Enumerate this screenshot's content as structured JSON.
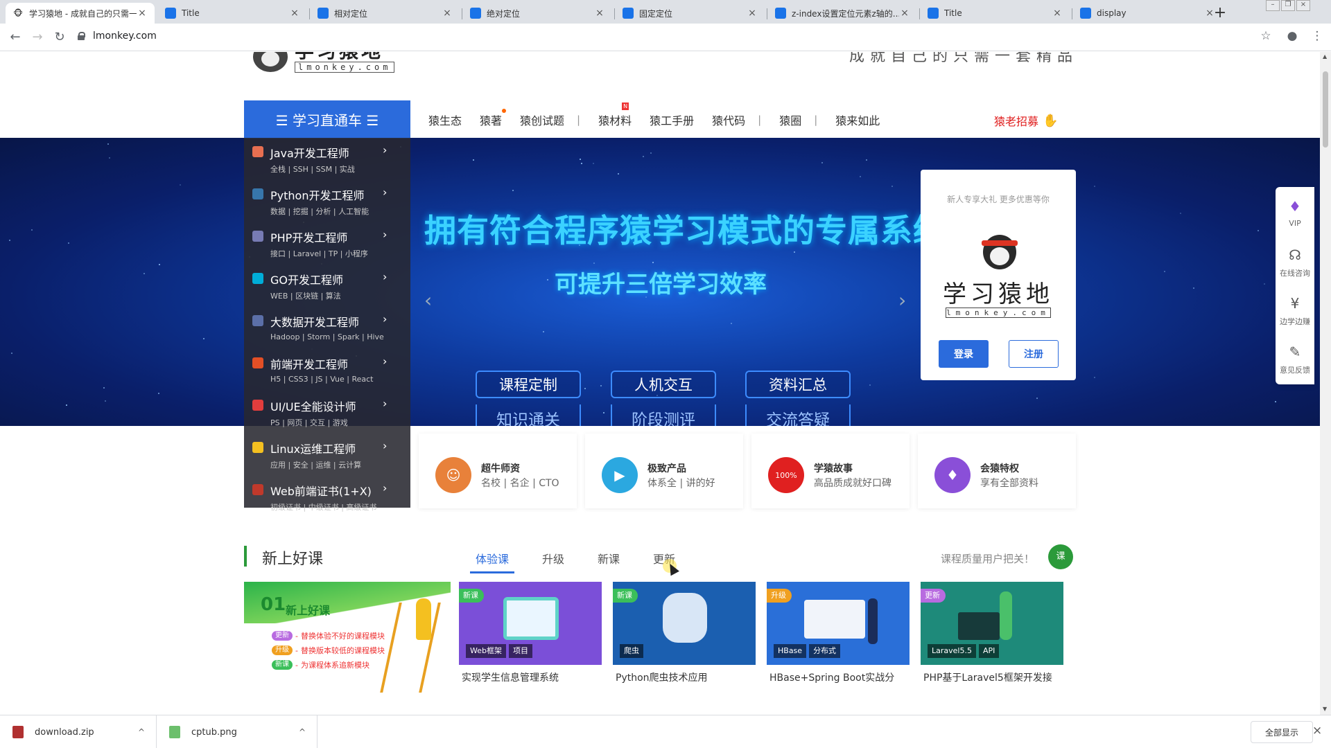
{
  "browser": {
    "tabs": [
      {
        "title": "学习猿地 - 成就自己的只需一...",
        "active": true
      },
      {
        "title": "Title",
        "active": false
      },
      {
        "title": "相对定位",
        "active": false
      },
      {
        "title": "绝对定位",
        "active": false
      },
      {
        "title": "固定定位",
        "active": false
      },
      {
        "title": "z-index设置定位元素z轴的...",
        "active": false
      },
      {
        "title": "Title",
        "active": false
      },
      {
        "title": "display",
        "active": false
      }
    ],
    "close_glyph": "×",
    "new_tab_glyph": "+",
    "url": "lmonkey.com"
  },
  "site": {
    "logo_cn": "学习猿地",
    "logo_en": "lmonkey.com",
    "slogan": "成就自己的只需一套精品",
    "learn_button": "☰ 学习直通车 ☰",
    "nav": [
      "猿生态",
      "猿著",
      "猿创试题",
      "猿材料",
      "猿工手册",
      "猿代码",
      "猿圈",
      "猿来如此"
    ],
    "recruit": "猿老招募",
    "menu": [
      {
        "title": "Java开发工程师",
        "sub": "全栈 | SSH | SSM | 实战",
        "color": "#e76f51"
      },
      {
        "title": "Python开发工程师",
        "sub": "数据 | 挖掘 | 分析 | 人工智能",
        "color": "#3776ab"
      },
      {
        "title": "PHP开发工程师",
        "sub": "接口 | Laravel | TP | 小程序",
        "color": "#777bb4"
      },
      {
        "title": "GO开发工程师",
        "sub": "WEB | 区块链 | 算法",
        "color": "#00add8"
      },
      {
        "title": "大数据开发工程师",
        "sub": "Hadoop | Storm | Spark | Hive",
        "color": "#5b6fa8"
      },
      {
        "title": "前端开发工程师",
        "sub": "H5 | CSS3 | JS | Vue | React",
        "color": "#e34f26"
      },
      {
        "title": "UI/UE全能设计师",
        "sub": "PS | 网页 | 交互 | 游戏",
        "color": "#e23d3d"
      },
      {
        "title": "Linux运维工程师",
        "sub": "应用 | 安全 | 运维 | 云计算",
        "color": "#f4c020"
      },
      {
        "title": "Web前端证书(1+X)",
        "sub": "初级证书 | 中级证书 | 高级证书",
        "color": "#c0392b"
      }
    ],
    "menu_arrow": "›",
    "banner": {
      "headline": "拥有符合程序猿学习模式的专属系统",
      "subline": "可提升三倍学习效率",
      "boxes": [
        "课程定制",
        "人机交互",
        "资料汇总"
      ],
      "plains": [
        "知识通关",
        "阶段测评",
        "交流答疑"
      ],
      "prev": "‹",
      "next": "›"
    },
    "login_card": {
      "tip": "新人专享大礼 更多优惠等你",
      "logo_cn": "学习猿地",
      "logo_en": "lmonkey.com",
      "login": "登录",
      "register": "注册"
    },
    "float_bar": [
      {
        "label": "VIP",
        "icon": "vip-diamond-icon",
        "glyph": "♦"
      },
      {
        "label": "在线咨询",
        "icon": "headset-icon",
        "glyph": "☊"
      },
      {
        "label": "边学边赚",
        "icon": "coin-icon",
        "glyph": "¥"
      },
      {
        "label": "意见反馈",
        "icon": "feedback-icon",
        "glyph": "✎"
      }
    ],
    "features": [
      {
        "title": "超牛师资",
        "sub": "名校 | 名企 | CTO",
        "icon": "teacher-icon",
        "glyph": "☺",
        "color": "#e8813a"
      },
      {
        "title": "极致产品",
        "sub": "体系全 | 讲的好",
        "icon": "play-icon",
        "glyph": "▶",
        "color": "#2ba8e0"
      },
      {
        "title": "学猿故事",
        "sub": "高品质成就好口碑",
        "icon": "thumbs-up-icon",
        "glyph": "100%",
        "color": "#e02020"
      },
      {
        "title": "会猿特权",
        "sub": "享有全部资料",
        "icon": "diamond-icon",
        "glyph": "♦",
        "color": "#8a4fd8"
      }
    ],
    "courses": {
      "title": "新上好课",
      "tabs": [
        "体验课",
        "升级",
        "新课",
        "更新"
      ],
      "right_text": "课程质量用户把关！",
      "badge": "课",
      "promo": {
        "num": "01",
        "head": "新上好课",
        "lines": [
          {
            "tag": "更新",
            "text": "替换体验不好的课程模块",
            "color": "#b86be0"
          },
          {
            "tag": "升级",
            "text": "替换版本较低的课程模块",
            "color": "#f0a020"
          },
          {
            "tag": "新课",
            "text": "为课程体系追新模块",
            "color": "#3bbf5a"
          }
        ]
      },
      "cards": [
        {
          "tag": "新课",
          "tag_color": "#3bbf5a",
          "chips": [
            "Web框架",
            "项目"
          ],
          "title": "实现学生信息管理系统",
          "bg": "#7b4fd8"
        },
        {
          "tag": "新课",
          "tag_color": "#3bbf5a",
          "chips": [
            "爬虫"
          ],
          "title": "Python爬虫技术应用",
          "bg": "#1b5fb0"
        },
        {
          "tag": "升级",
          "tag_color": "#f0a020",
          "chips": [
            "HBase",
            "分布式"
          ],
          "title": "HBase+Spring Boot实战分",
          "bg": "#2a6fd8"
        },
        {
          "tag": "更新",
          "tag_color": "#b86be0",
          "chips": [
            "Laravel5.5",
            "API"
          ],
          "title": "PHP基于Laravel5框架开发接",
          "bg": "#1e8a7a"
        }
      ]
    }
  },
  "downloads": {
    "items": [
      "download.zip",
      "cptub.png"
    ],
    "show_all": "全部显示",
    "close": "×",
    "caret": "^"
  }
}
